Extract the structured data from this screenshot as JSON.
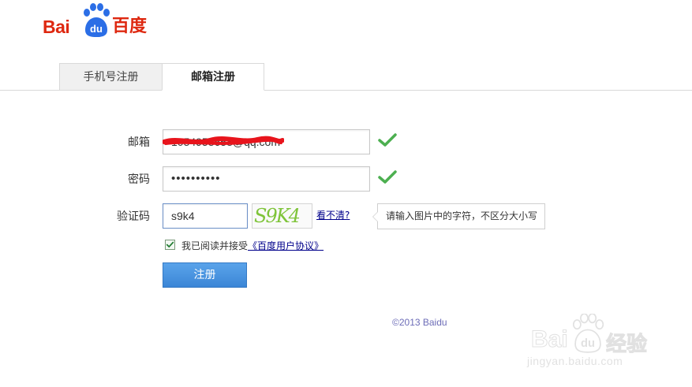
{
  "brand": {
    "logo_latin": "Bai",
    "logo_paw_text": "du",
    "logo_cn": "百度",
    "color": "#de2810"
  },
  "tabs": [
    {
      "label": "手机号注册",
      "active": false
    },
    {
      "label": "邮箱注册",
      "active": true
    }
  ],
  "form": {
    "email": {
      "label": "邮箱",
      "value": "1054958658@qq.com",
      "valid": true,
      "redacted": true
    },
    "password": {
      "label": "密码",
      "value": "••••••••••",
      "valid": true
    },
    "captcha": {
      "label": "验证码",
      "value": "s9k4",
      "image_text": "S9K4",
      "refresh_link": "看不清?",
      "tip": "请输入图片中的字符，不区分大小写"
    },
    "agreement": {
      "checked": true,
      "text": "我已阅读并接受",
      "link": "《百度用户协议》"
    },
    "submit_label": "注册"
  },
  "footer": {
    "copyright": "©2013 Baidu"
  },
  "watermark": {
    "latin": "Bai",
    "paw_text": "du",
    "cn": "经验",
    "url": "jingyan.baidu.com"
  },
  "colors": {
    "check_green": "#4caf50",
    "link_blue": "#00008b",
    "button_blue": "#3b86d6"
  },
  "icons": {
    "valid": "check-icon",
    "logo": "paw-icon"
  }
}
